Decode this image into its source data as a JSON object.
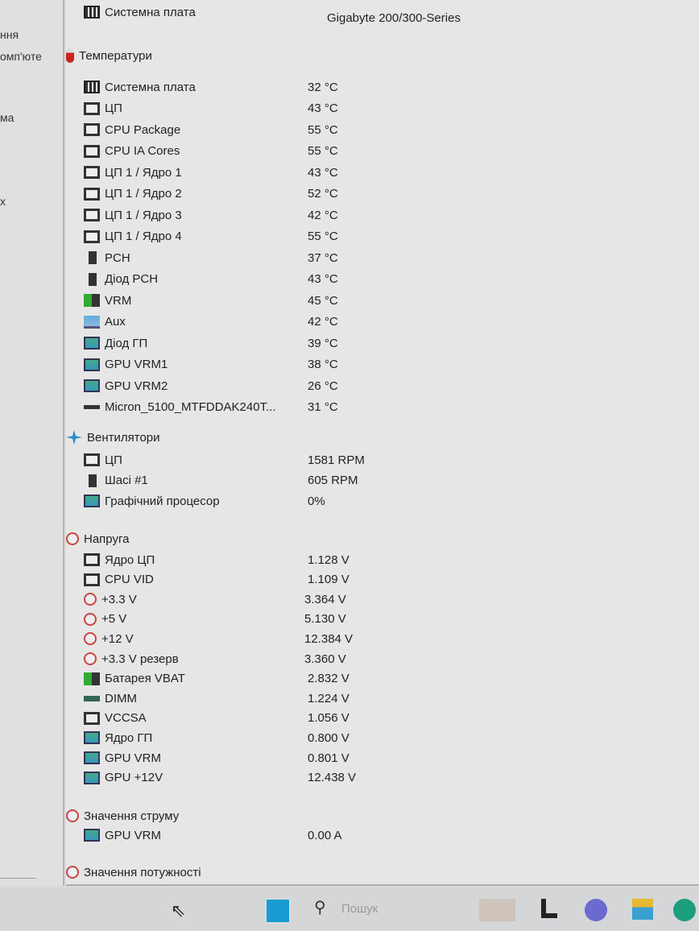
{
  "left_panel": [
    "ння",
    "омп'юте",
    "ма",
    "х"
  ],
  "header_row": {
    "label": "Системна плата",
    "value": "Gigabyte 200/300-Series",
    "icon": "motherboard-icon"
  },
  "sections": [
    {
      "title": "Температури",
      "icon": "thermometer-icon",
      "rows": [
        {
          "label": "Системна плата",
          "value": "32 °C",
          "icon": "board"
        },
        {
          "label": "ЦП",
          "value": "43 °C",
          "icon": "chip"
        },
        {
          "label": "CPU Package",
          "value": "55 °C",
          "icon": "chip"
        },
        {
          "label": "CPU IA Cores",
          "value": "55 °C",
          "icon": "chip"
        },
        {
          "label": "ЦП 1 / Ядро 1",
          "value": "43 °C",
          "icon": "chip"
        },
        {
          "label": "ЦП 1 / Ядро 2",
          "value": "52 °C",
          "icon": "chip"
        },
        {
          "label": "ЦП 1 / Ядро 3",
          "value": "42 °C",
          "icon": "chip"
        },
        {
          "label": "ЦП 1 / Ядро 4",
          "value": "55 °C",
          "icon": "chip"
        },
        {
          "label": "PCH",
          "value": "37 °C",
          "icon": "pch"
        },
        {
          "label": "Діод PCH",
          "value": "43 °C",
          "icon": "pch"
        },
        {
          "label": "VRM",
          "value": "45 °C",
          "icon": "vrm"
        },
        {
          "label": "Aux",
          "value": "42 °C",
          "icon": "mon"
        },
        {
          "label": "Діод ГП",
          "value": "39 °C",
          "icon": "gpu"
        },
        {
          "label": "GPU VRM1",
          "value": "38 °C",
          "icon": "gpu"
        },
        {
          "label": "GPU VRM2",
          "value": "26 °C",
          "icon": "gpu"
        },
        {
          "label": "Micron_5100_MTFDDAK240T...",
          "value": "31 °C",
          "icon": "ssd"
        }
      ]
    },
    {
      "title": "Вентилятори",
      "icon": "fan-icon",
      "rows": [
        {
          "label": "ЦП",
          "value": "1581 RPM",
          "icon": "chip"
        },
        {
          "label": "Шасі #1",
          "value": "605 RPM",
          "icon": "pch"
        },
        {
          "label": "Графічний процесор",
          "value": "0%",
          "icon": "gpu"
        }
      ]
    },
    {
      "title": "Напруга",
      "icon": "voltage-icon",
      "rows": [
        {
          "label": "Ядро ЦП",
          "value": "1.128 V",
          "icon": "chip"
        },
        {
          "label": "CPU VID",
          "value": "1.109 V",
          "icon": "chip"
        },
        {
          "label": "+3.3 V",
          "value": "3.364 V",
          "icon": "volt"
        },
        {
          "label": "+5 V",
          "value": "5.130 V",
          "icon": "volt"
        },
        {
          "label": "+12 V",
          "value": "12.384 V",
          "icon": "volt"
        },
        {
          "label": "+3.3 V резерв",
          "value": "3.360 V",
          "icon": "volt"
        },
        {
          "label": "Батарея VBAT",
          "value": "2.832 V",
          "icon": "vrm"
        },
        {
          "label": "DIMM",
          "value": "1.224 V",
          "icon": "dimm"
        },
        {
          "label": "VCCSA",
          "value": "1.056 V",
          "icon": "chip"
        },
        {
          "label": "Ядро ГП",
          "value": "0.800 V",
          "icon": "gpu"
        },
        {
          "label": "GPU VRM",
          "value": "0.801 V",
          "icon": "gpu"
        },
        {
          "label": "GPU +12V",
          "value": "12.438 V",
          "icon": "gpu"
        }
      ]
    },
    {
      "title": "Значення струму",
      "icon": "current-icon",
      "rows": [
        {
          "label": "GPU VRM",
          "value": "0.00 A",
          "icon": "gpu"
        }
      ]
    },
    {
      "title": "Значення потужності",
      "icon": "power-icon",
      "rows": []
    }
  ],
  "taskbar": {
    "search_placeholder": "Пошук"
  }
}
